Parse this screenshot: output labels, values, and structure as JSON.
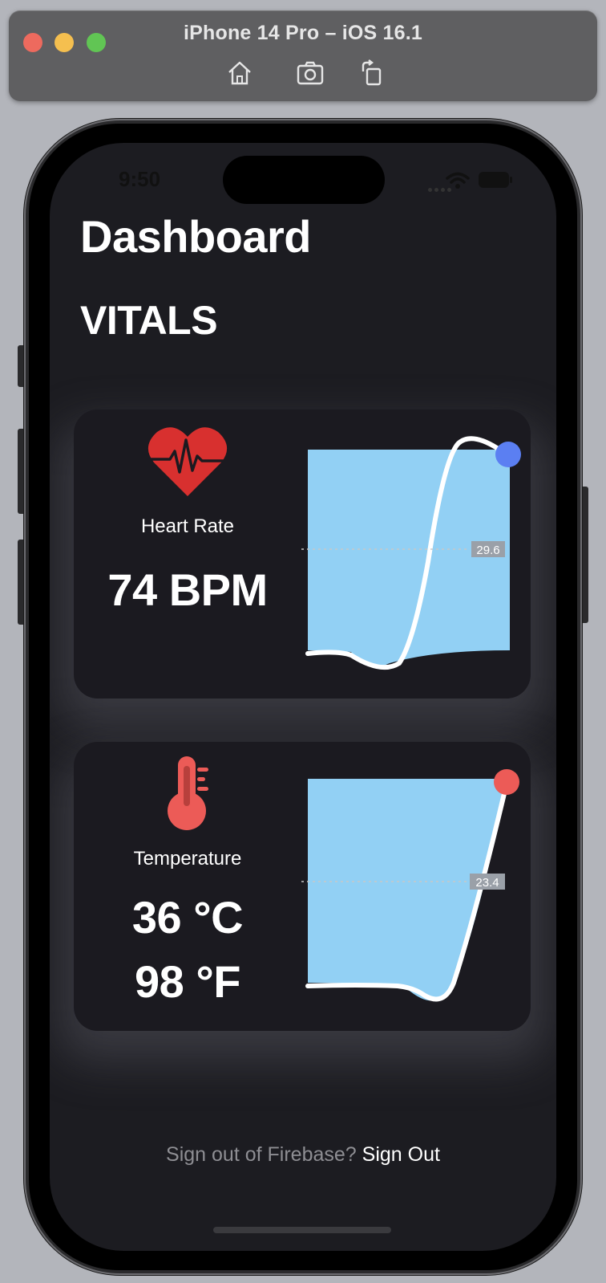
{
  "simulator": {
    "title": "iPhone 14 Pro – iOS 16.1",
    "toolbar": [
      {
        "icon": "home-icon"
      },
      {
        "icon": "screenshot-icon"
      },
      {
        "icon": "rotate-icon"
      }
    ]
  },
  "status_bar": {
    "time": "9:50"
  },
  "screen": {
    "title": "Dashboard",
    "section": "VITALS"
  },
  "cards": [
    {
      "icon": "heart-rate-icon",
      "label": "Heart Rate",
      "values": [
        "74 BPM"
      ],
      "chart": {
        "marker_label": "29.6",
        "dot_color": "#5b7ff2"
      }
    },
    {
      "icon": "thermometer-icon",
      "label": "Temperature",
      "values": [
        "36 °C",
        "98 °F"
      ],
      "chart": {
        "marker_label": "23.4",
        "dot_color": "#ec5b57"
      }
    }
  ],
  "footer": {
    "question": "Sign out of Firebase?",
    "link": "Sign Out"
  },
  "colors": {
    "background": "#1c1c21",
    "card": "#1b1a20",
    "chart_fill": "#92d0f4",
    "heart": "#d8302f",
    "thermometer": "#ec5b57"
  }
}
